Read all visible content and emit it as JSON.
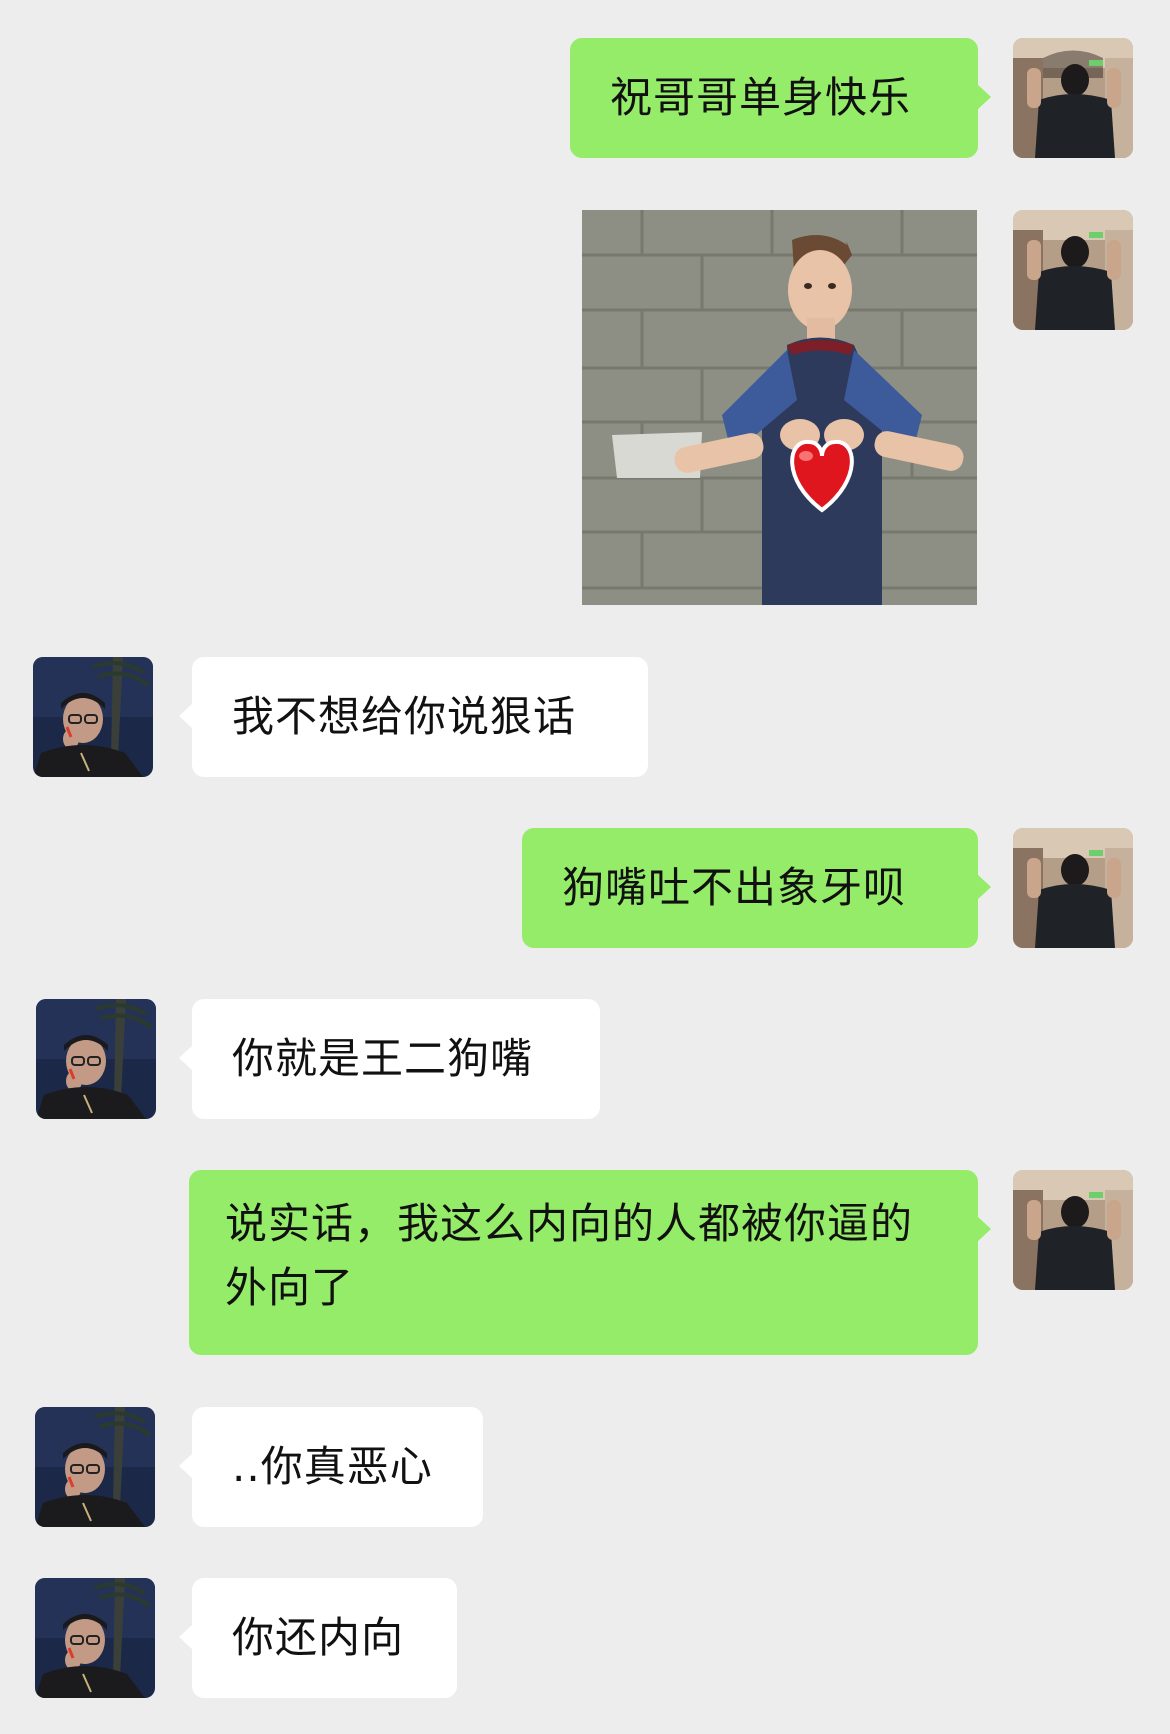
{
  "conversation": {
    "messages": [
      {
        "side": "right",
        "type": "text",
        "text": "祝哥哥单身快乐"
      },
      {
        "side": "right",
        "type": "sticker",
        "sticker": "boy-making-heart-hands-sticker"
      },
      {
        "side": "left",
        "type": "text",
        "text": "我不想给你说狠话"
      },
      {
        "side": "right",
        "type": "text",
        "text": "狗嘴吐不出象牙呗"
      },
      {
        "side": "left",
        "type": "text",
        "text": "你就是王二狗嘴"
      },
      {
        "side": "right",
        "type": "text",
        "text": "说实话，我这么内向的人都被你逼的外向了"
      },
      {
        "side": "left",
        "type": "text",
        "text": "..你真恶心"
      },
      {
        "side": "left",
        "type": "text",
        "text": "你还内向"
      }
    ]
  },
  "colors": {
    "background": "#ededed",
    "sent_bubble": "#95ec69",
    "received_bubble": "#ffffff"
  }
}
